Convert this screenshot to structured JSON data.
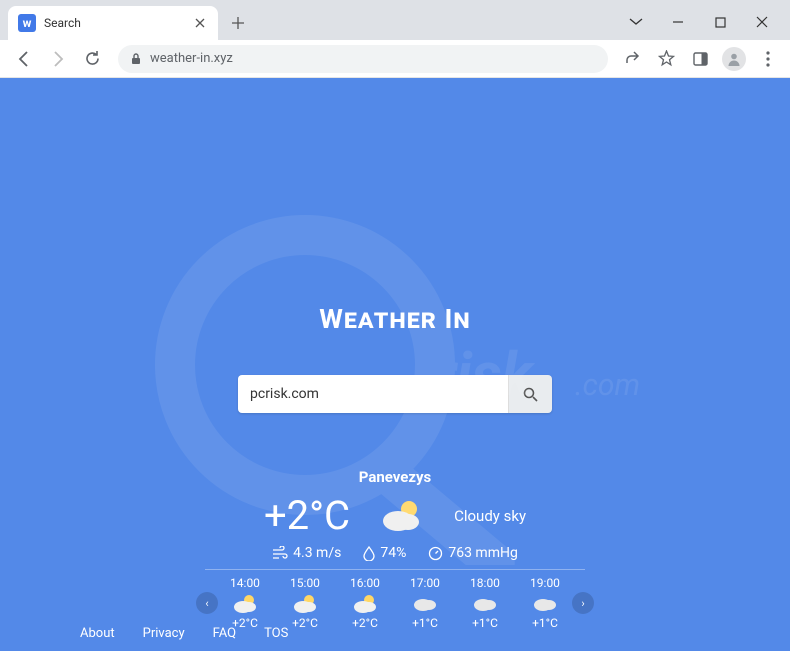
{
  "browser": {
    "tab_title": "Search",
    "url": "weather-in.xyz"
  },
  "page": {
    "logo": "Weather In",
    "search_value": "pcrisk.com",
    "city": "Panevezys",
    "temp": "+2°C",
    "condition": "Cloudy sky",
    "wind": "4.3 m/s",
    "humidity": "74%",
    "pressure": "763 mmHg",
    "forecast": [
      {
        "time": "14:00",
        "temp": "+2°C",
        "sunny": true
      },
      {
        "time": "15:00",
        "temp": "+2°C",
        "sunny": true
      },
      {
        "time": "16:00",
        "temp": "+2°C",
        "sunny": true
      },
      {
        "time": "17:00",
        "temp": "+1°C",
        "sunny": false
      },
      {
        "time": "18:00",
        "temp": "+1°C",
        "sunny": false
      },
      {
        "time": "19:00",
        "temp": "+1°C",
        "sunny": false
      }
    ],
    "footer": {
      "about": "About",
      "privacy": "Privacy",
      "faq": "FAQ",
      "tos": "TOS"
    }
  }
}
